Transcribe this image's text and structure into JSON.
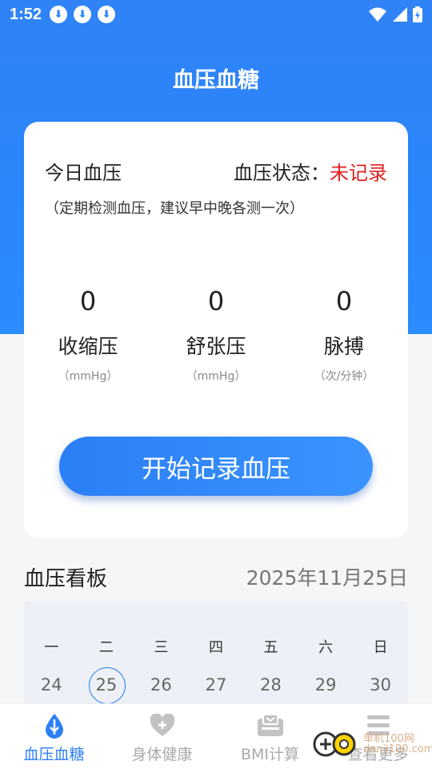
{
  "status_bar": {
    "time": "1:52",
    "download_icons": [
      "download-icon",
      "download-icon",
      "download-icon"
    ],
    "system_icons": [
      "wifi-icon",
      "signal-icon",
      "battery-icon"
    ]
  },
  "header": {
    "title": "血压血糖"
  },
  "card": {
    "today_label": "今日血压",
    "status_label": "血压状态：",
    "status_value": "未记录",
    "hint": "（定期检测血压，建议早中晚各测一次）",
    "metrics": [
      {
        "value": "0",
        "name": "收缩压",
        "unit": "（mmHg）"
      },
      {
        "value": "0",
        "name": "舒张压",
        "unit": "（mmHg）"
      },
      {
        "value": "0",
        "name": "脉搏",
        "unit": "（次/分钟）"
      }
    ],
    "start_button": "开始记录血压"
  },
  "board": {
    "title": "血压看板",
    "date": "2025年11月25日",
    "weekdays": [
      "一",
      "二",
      "三",
      "四",
      "五",
      "六",
      "日"
    ],
    "days": [
      "24",
      "25",
      "26",
      "27",
      "28",
      "29",
      "30"
    ],
    "selected_day": "25"
  },
  "tabbar": {
    "tabs": [
      {
        "label": "血压血糖",
        "icon": "blood-drop-icon",
        "active": true
      },
      {
        "label": "身体健康",
        "icon": "heart-plus-icon",
        "active": false
      },
      {
        "label": "BMI计算",
        "icon": "scale-icon",
        "active": false
      },
      {
        "label": "查看更多",
        "icon": "menu-icon",
        "active": false
      }
    ]
  },
  "watermark": {
    "line1": "单机100网",
    "line2": "danji100.com"
  },
  "colors": {
    "primary": "#2b7ff6",
    "status_red": "#e02020",
    "inactive": "#aaaaaa"
  }
}
